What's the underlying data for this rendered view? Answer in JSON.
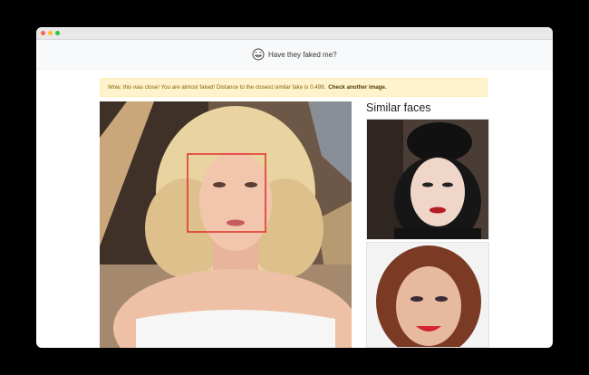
{
  "navbar": {
    "brand_text": "Have they faked me?",
    "brand_icon": "troll-face-icon"
  },
  "alert": {
    "message": "Wow, this was close! You are almost faked! Distance to the closest similar fake is 0.499.",
    "link_label": "Check another image."
  },
  "sidebar": {
    "title": "Similar faces"
  },
  "colors": {
    "alert_bg": "#fff3cd",
    "alert_text": "#856404",
    "face_box": "#e0231f"
  }
}
